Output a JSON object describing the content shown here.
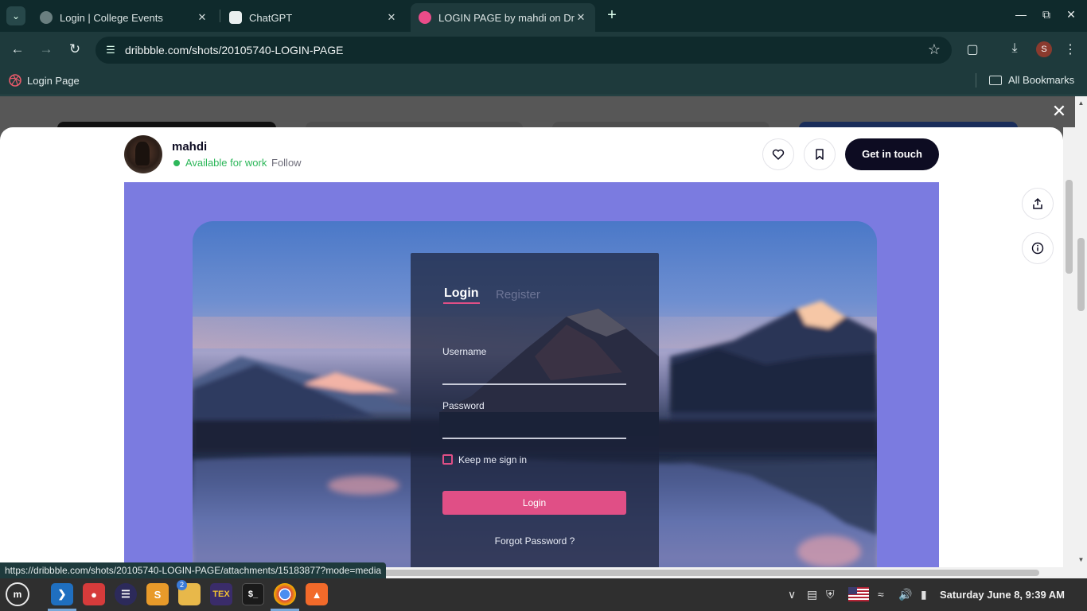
{
  "browser": {
    "tabs": [
      {
        "title": "Login | College Events",
        "active": false
      },
      {
        "title": "ChatGPT",
        "active": false
      },
      {
        "title": "LOGIN PAGE by mahdi on Dri",
        "active": true
      }
    ],
    "url": "dribbble.com/shots/20105740-LOGIN-PAGE",
    "profile_initial": "S",
    "bookmarks": [
      {
        "label": "Login Page",
        "icon": "dribbble-icon"
      }
    ],
    "all_bookmarks": "All Bookmarks",
    "status_url": "https://dribbble.com/shots/20105740-LOGIN-PAGE/attachments/15183877?mode=media"
  },
  "shot_header": {
    "author": "mahdi",
    "availability": "Available for work",
    "follow": "Follow",
    "cta": "Get in touch"
  },
  "shot_image": {
    "tabs": {
      "login": "Login",
      "register": "Register"
    },
    "username_label": "Username",
    "password_label": "Password",
    "keep_signed_in": "Keep me sign in",
    "login_button": "Login",
    "forgot_password": "Forgot Password ?"
  },
  "taskbar": {
    "apps": [
      "mint-menu-icon",
      "vscode-icon",
      "app-red-icon",
      "eclipse-icon",
      "sublime-icon",
      "files-icon",
      "texstudio-icon",
      "terminal-icon",
      "chrome-icon",
      "brave-icon"
    ],
    "files_badge": "2",
    "sublime_letter": "S",
    "texstudio_label": "TEX",
    "terminal_label": "$_",
    "clock": "Saturday June  8, 9:39 AM"
  },
  "colors": {
    "browser_frame": "#1e3a3c",
    "shot_background": "#7b7be0",
    "accent_pink": "#e04f86",
    "available_green": "#2db75a",
    "cta_dark": "#0d0c22"
  }
}
